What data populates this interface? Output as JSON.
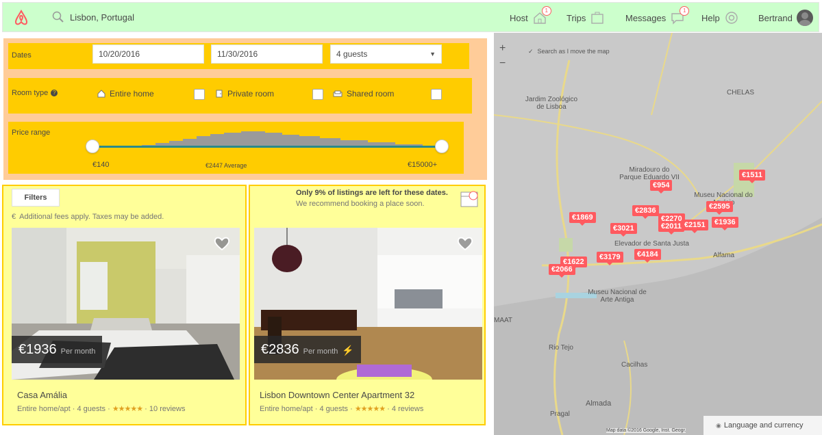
{
  "header": {
    "search_location": "Lisbon, Portugal",
    "nav": {
      "host": "Host",
      "trips": "Trips",
      "messages": "Messages",
      "help": "Help",
      "user": "Bertrand"
    },
    "host_badge": "1",
    "messages_badge": "1",
    "brand_color": "#ff5a5f"
  },
  "filters": {
    "dates_label": "Dates",
    "check_in": "10/20/2016",
    "check_out": "11/30/2016",
    "guests": "4 guests",
    "room_type_label": "Room type",
    "room_types": [
      "Entire home",
      "Private room",
      "Shared room"
    ],
    "price_range_label": "Price range",
    "price_min": "€140",
    "price_avg": "€2447 Average",
    "price_max": "€15000+",
    "filters_button": "Filters",
    "fees_note": "Additional fees apply. Taxes may be added."
  },
  "notice": {
    "line1": "Only 9% of listings are left for these dates.",
    "line2": "We recommend booking a place soon."
  },
  "listings": [
    {
      "price": "€1936",
      "per": "Per month",
      "title": "Casa Amália",
      "type": "Entire home/apt",
      "guests": "4 guests",
      "stars": "★★★★★",
      "reviews": "10 reviews"
    },
    {
      "price": "€2836",
      "per": "Per month",
      "title": "Lisbon Downtown Center Apartment 32",
      "type": "Entire home/apt",
      "guests": "4 guests",
      "stars": "★★★★★",
      "reviews": "4 reviews"
    }
  ],
  "map": {
    "search_as_move": "Search as I move the map",
    "zoom_in": "+",
    "zoom_out": "−",
    "language_currency": "Language and currency",
    "attribution": "Map data ©2016 Google, Inst. Geogr.",
    "labels": [
      "Jardim Zoológico de Lisboa",
      "Miradouro do Parque Eduardo VII",
      "Museu Nacional do Azulejo",
      "Elevador de Santa Justa",
      "Alfama",
      "Museu Nacional de Arte Antiga",
      "CHELAS",
      "Almada",
      "Cacilhas",
      "Pragal",
      "Rio Tejo",
      "MAAT"
    ],
    "pins": [
      "€1511",
      "€954",
      "€2595",
      "€1869",
      "€2836",
      "€2270",
      "€3021",
      "€2011",
      "€2151",
      "€1936",
      "€1622",
      "€3179",
      "€4184",
      "€2066"
    ]
  }
}
